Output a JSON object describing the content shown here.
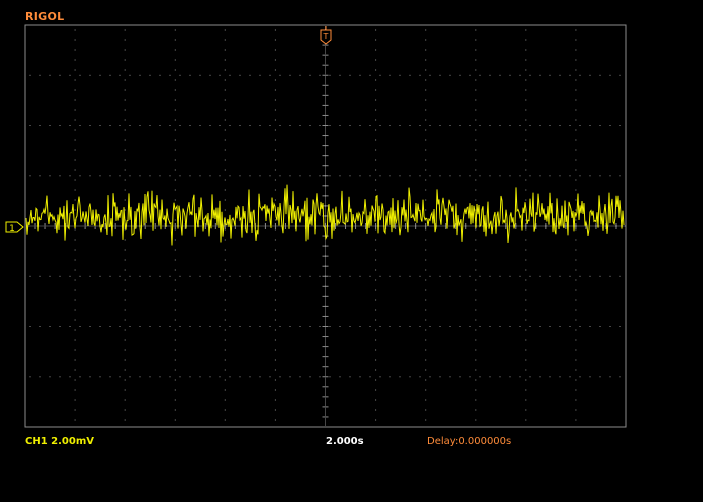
{
  "brand": "RIGOL",
  "channel": {
    "label": "CH1",
    "scale": "2.00mV",
    "marker": "1",
    "color": "#f0f000"
  },
  "timebase": "2.000s",
  "delay": "Delay:0.000000s",
  "trigger": {
    "marker": "T"
  },
  "colors": {
    "brand": "#ff8c3a",
    "trace": "#f0f000",
    "grid": "#8c8c8c",
    "status_text": "#f0f000",
    "delay_text": "#ff8c3a",
    "trigger": "#ff8c3a",
    "background": "#000000"
  }
}
